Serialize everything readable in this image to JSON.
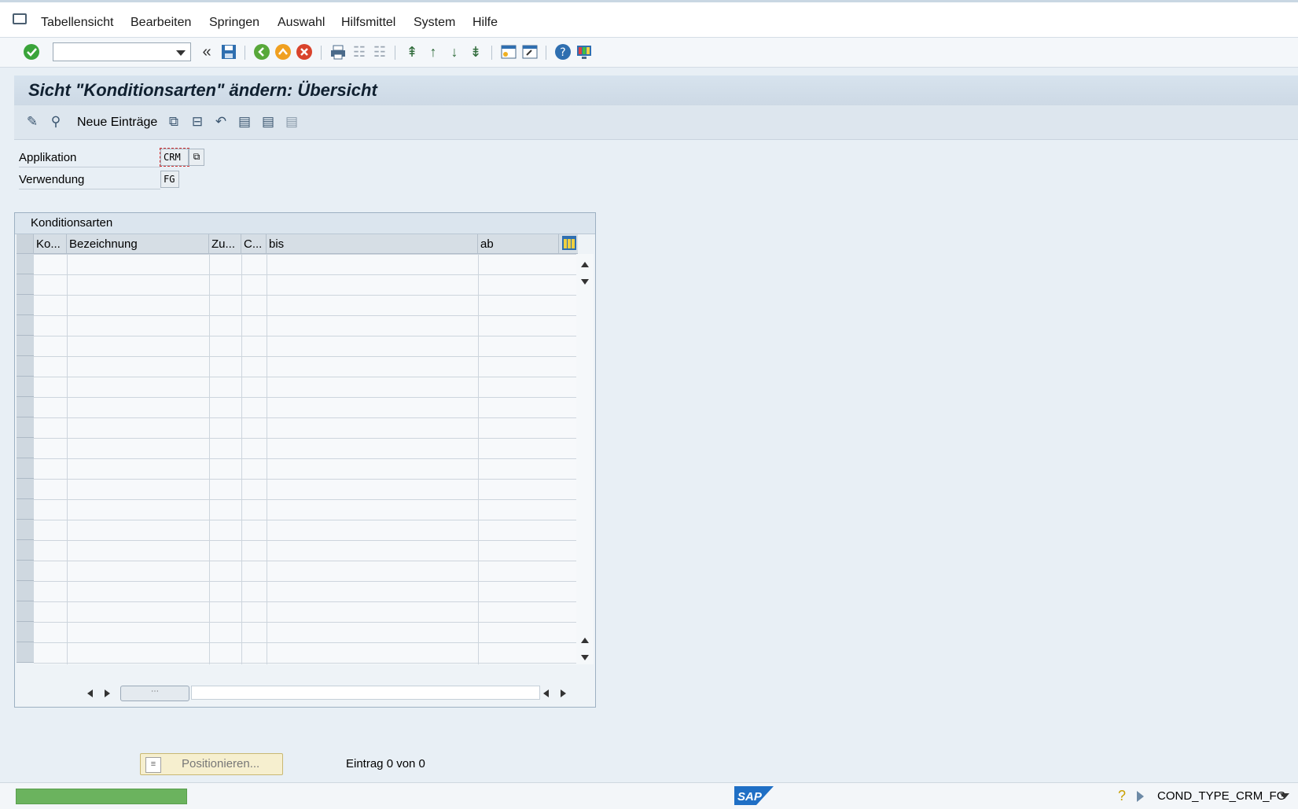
{
  "menu": {
    "items": [
      "Tabellensicht",
      "Bearbeiten",
      "Springen",
      "Auswahl",
      "Hilfsmittel",
      "System",
      "Hilfe"
    ]
  },
  "toolbar": {
    "command_field_value": "",
    "back_label": "«"
  },
  "screen": {
    "title": "Sicht \"Konditionsarten\" ändern: Übersicht"
  },
  "app_toolbar": {
    "new_entries_label": "Neue Einträge"
  },
  "fields": {
    "applikation_label": "Applikation",
    "applikation_value": "CRM",
    "verwendung_label": "Verwendung",
    "verwendung_value": "FG"
  },
  "table": {
    "title": "Konditionsarten",
    "columns": [
      "Ko...",
      "Bezeichnung",
      "Zu...",
      "C...",
      "bis",
      "ab"
    ],
    "rows": []
  },
  "bottom": {
    "position_button_label": "Positionieren...",
    "entry_info": "Eintrag 0 von 0"
  },
  "status": {
    "sap_logo_text": "SAP",
    "system_info": "COND_TYPE_CRM_FG"
  },
  "colors": {
    "accent": "#2f6fb0",
    "status_green": "#6bb35e"
  }
}
